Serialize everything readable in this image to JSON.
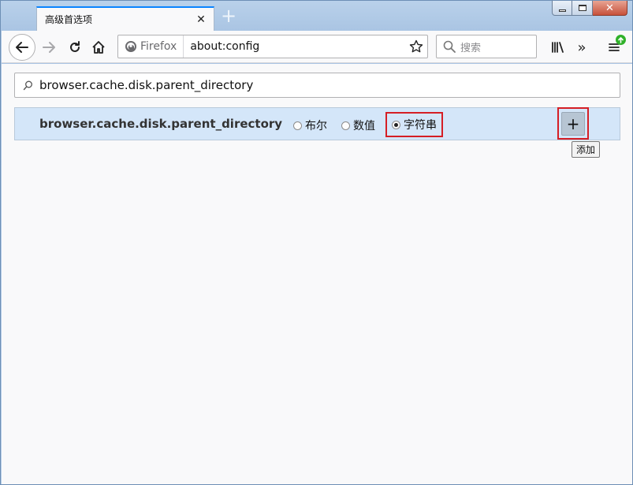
{
  "window": {
    "tab_title": "高级首选项",
    "new_tab_symbol": "+"
  },
  "navbar": {
    "identity_label": "Firefox",
    "url": "about:config",
    "search_placeholder": "搜索",
    "overflow_symbol": "»"
  },
  "config": {
    "filter_value": "browser.cache.disk.parent_directory",
    "new_pref_name": "browser.cache.disk.parent_directory",
    "types": [
      {
        "label": "布尔",
        "checked": false
      },
      {
        "label": "数值",
        "checked": false
      },
      {
        "label": "字符串",
        "checked": true
      }
    ],
    "add_symbol": "+",
    "add_tooltip": "添加"
  },
  "colors": {
    "accent": "#0a84ff",
    "highlight_box": "#d51e25",
    "row_bg": "#d4e6f9",
    "update_badge": "#30b12a"
  }
}
